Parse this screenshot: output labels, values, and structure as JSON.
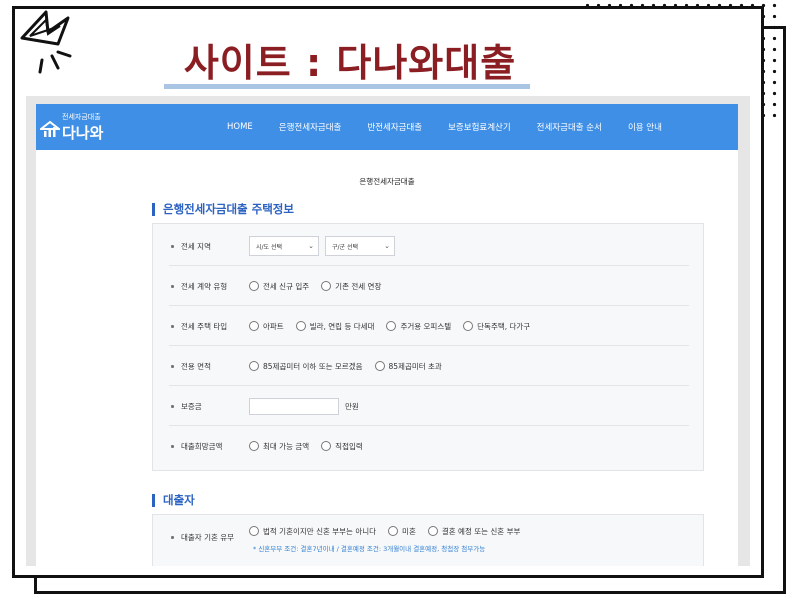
{
  "page_title": "사이트 : 다나와대출",
  "logo": {
    "small": "전세자금대출",
    "big": "다나와"
  },
  "nav": {
    "items": [
      "HOME",
      "은행전세자금대출",
      "반전세자금대출",
      "보증보험료계산기",
      "전세자금대출 순서",
      "이용 안내"
    ]
  },
  "page_heading": "은행전세자금대출",
  "section1": {
    "title": "은행전세자금대출 주택정보",
    "rows": {
      "region": {
        "label": "전세 지역",
        "select1": "시/도 선택",
        "select2": "구/군 선택"
      },
      "contract": {
        "label": "전세 계약 유형",
        "options": [
          "전세 신규 입주",
          "기존 전세 연장"
        ]
      },
      "house_type": {
        "label": "전세 주택 타입",
        "options": [
          "아파트",
          "빌라, 연립 등 다세대",
          "주거용 오피스텔",
          "단독주택, 다가구"
        ]
      },
      "area": {
        "label": "전용 면적",
        "options": [
          "85제곱미터 이하 또는 모르겠음",
          "85제곱미터 초과"
        ]
      },
      "deposit": {
        "label": "보증금",
        "unit": "만원"
      },
      "loan_amount": {
        "label": "대출희망금액",
        "options": [
          "최대 가능 금액",
          "직접입력"
        ]
      }
    }
  },
  "section2": {
    "title": "대출자",
    "rows": {
      "marital": {
        "label": "대출자 기혼 유무",
        "options": [
          "법적 기혼이지만 신혼 부부는 아니다",
          "미혼",
          "결혼 예정 또는 신혼 부부"
        ],
        "note": "* 신혼부부 조건: 결혼7년이내 / 결혼예정 조건: 3개월이내 결혼예정, 청첩장 첨부가능"
      }
    }
  },
  "colors": {
    "title": "#8b1e22",
    "nav": "#3f8fe6",
    "section": "#2c63c2",
    "note": "#2f7fd4"
  }
}
